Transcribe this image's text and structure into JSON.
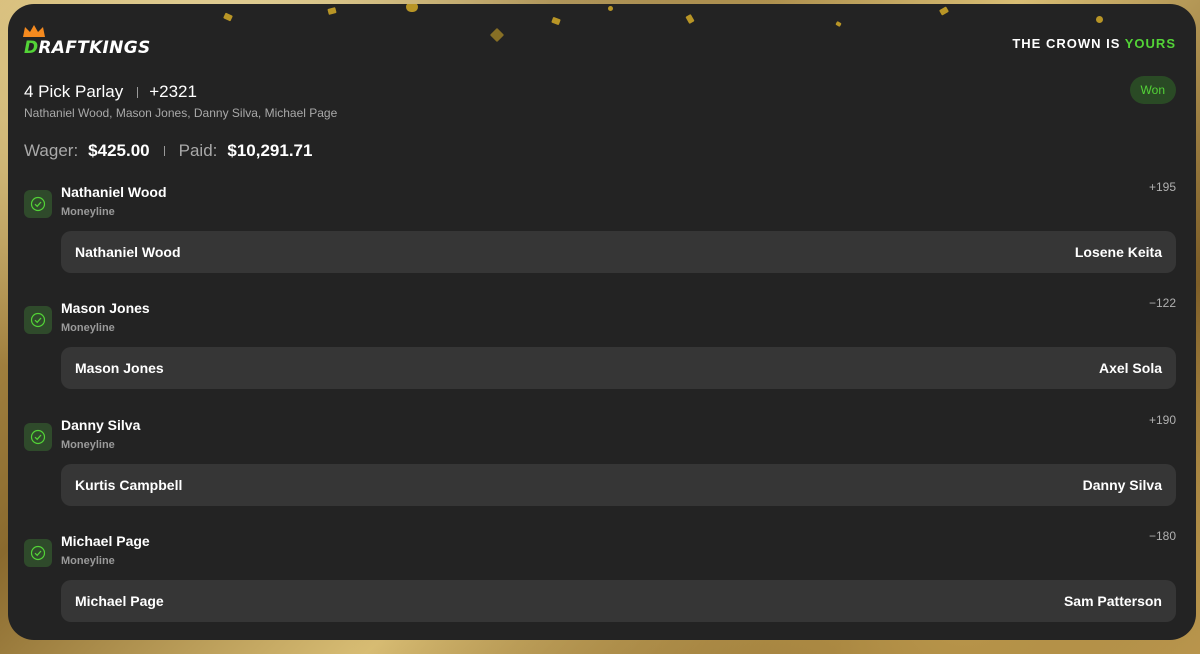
{
  "brand": {
    "logo_prefix": "D",
    "logo_rest": "RAFTKINGS",
    "tagline_prefix": "THE CROWN IS ",
    "tagline_highlight": "YOURS"
  },
  "bet": {
    "title": "4 Pick Parlay",
    "odds": "+2321",
    "participants": "Nathaniel Wood, Mason Jones, Danny Silva, Michael Page",
    "status": "Won",
    "wager_label": "Wager:",
    "wager_value": "$425.00",
    "paid_label": "Paid:",
    "paid_value": "$10,291.71"
  },
  "legs": [
    {
      "pick": "Nathaniel Wood",
      "market": "Moneyline",
      "odds": "+195",
      "fighter_left": "Nathaniel Wood",
      "fighter_right": "Losene Keita"
    },
    {
      "pick": "Mason Jones",
      "market": "Moneyline",
      "odds": "−122",
      "fighter_left": "Mason Jones",
      "fighter_right": "Axel Sola"
    },
    {
      "pick": "Danny Silva",
      "market": "Moneyline",
      "odds": "+190",
      "fighter_left": "Kurtis Campbell",
      "fighter_right": "Danny Silva"
    },
    {
      "pick": "Michael Page",
      "market": "Moneyline",
      "odds": "−180",
      "fighter_left": "Michael Page",
      "fighter_right": "Sam Patterson"
    }
  ],
  "colors": {
    "accent_green": "#53d337",
    "card_bg": "#232323",
    "matchup_bg": "#363636",
    "gold": "#c9a227"
  }
}
